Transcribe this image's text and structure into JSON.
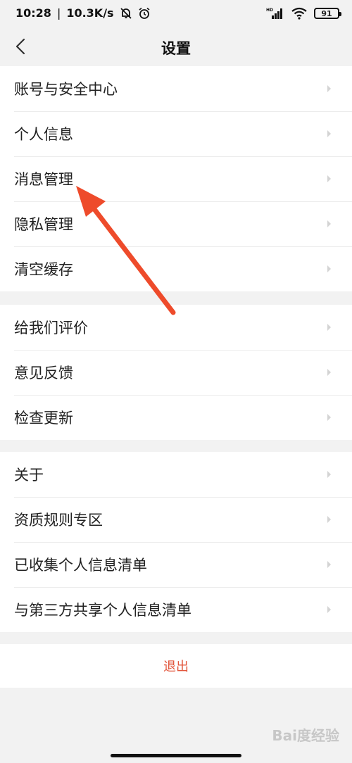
{
  "status_bar": {
    "time": "10:28",
    "separator": "|",
    "speed": "10.3K/s",
    "battery": "91",
    "hd_label": "HD"
  },
  "nav": {
    "title": "设置",
    "back_icon": "chevron-left-icon"
  },
  "groups": [
    {
      "items": [
        {
          "label": "账号与安全中心"
        },
        {
          "label": "个人信息"
        },
        {
          "label": "消息管理"
        },
        {
          "label": "隐私管理"
        },
        {
          "label": "清空缓存"
        }
      ]
    },
    {
      "items": [
        {
          "label": "给我们评价"
        },
        {
          "label": "意见反馈"
        },
        {
          "label": "检查更新"
        }
      ]
    },
    {
      "items": [
        {
          "label": "关于"
        },
        {
          "label": "资质规则专区"
        },
        {
          "label": "已收集个人信息清单"
        },
        {
          "label": "与第三方共享个人信息清单"
        }
      ]
    }
  ],
  "logout": {
    "label": "退出"
  },
  "watermark": {
    "text": "Bai度经验"
  },
  "colors": {
    "accent": "#e2563c",
    "arrow": "#ee4b2b",
    "background": "#f2f2f2"
  }
}
